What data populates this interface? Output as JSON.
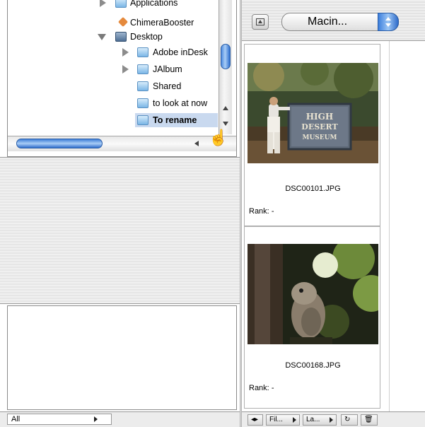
{
  "folder_tree": {
    "items": [
      {
        "label": "Applications",
        "icon": "folder-icon"
      },
      {
        "label": "ChimeraBooster",
        "icon": "app-icon"
      },
      {
        "label": "Desktop",
        "icon": "desktop-folder-icon"
      },
      {
        "label": "Adobe inDesk",
        "icon": "folder-icon"
      },
      {
        "label": "JAlbum",
        "icon": "folder-icon"
      },
      {
        "label": "Shared",
        "icon": "folder-icon"
      },
      {
        "label": "to look at now",
        "icon": "folder-icon"
      },
      {
        "label": "To rename",
        "icon": "folder-icon"
      }
    ]
  },
  "filter": {
    "selected": "All"
  },
  "toolbar": {
    "volume": "Macin..."
  },
  "thumbnails": [
    {
      "filename": "DSC00101.JPG",
      "rank_label": "Rank:",
      "rank_value": "-"
    },
    {
      "filename": "DSC00168.JPG",
      "rank_label": "Rank:",
      "rank_value": "-"
    }
  ],
  "bottom_bar": {
    "sort_label": "Fil...",
    "sort2_label": "La..."
  },
  "colors": {
    "accent": "#3d7fdc",
    "selection": "#c9d9ef"
  }
}
